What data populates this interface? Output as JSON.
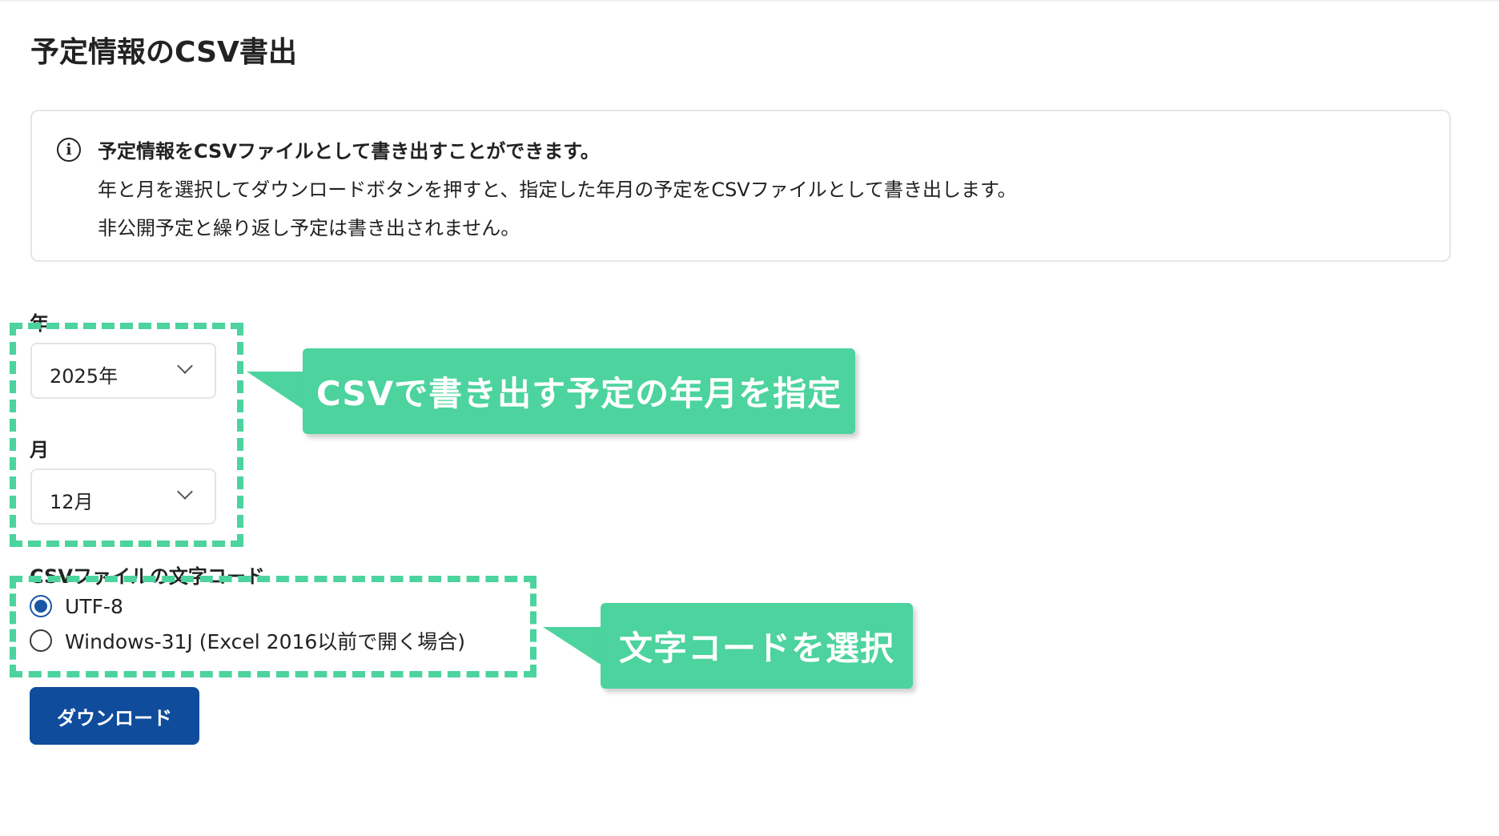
{
  "page": {
    "title": "予定情報のCSV書出"
  },
  "info": {
    "icon": "info-icon",
    "line1": "予定情報をCSVファイルとして書き出すことができます。",
    "line2": "年と月を選択してダウンロードボタンを押すと、指定した年月の予定をCSVファイルとして書き出します。",
    "line3": "非公開予定と繰り返し予定は書き出されません。"
  },
  "form": {
    "year_label": "年",
    "year_value": "2025年",
    "month_label": "月",
    "month_value": "12月",
    "encoding_label": "CSVファイルの文字コード",
    "encoding_options": [
      {
        "label": "UTF-8",
        "checked": true
      },
      {
        "label": "Windows-31J (Excel 2016以前で開く場合)",
        "checked": false
      }
    ],
    "download_label": "ダウンロード"
  },
  "annotations": {
    "callout_date": "CSVで書き出す予定の年月を指定",
    "callout_encoding": "文字コードを選択",
    "highlight_color": "#4cd39e"
  },
  "colors": {
    "primary_button": "#0f4c9c",
    "radio_checked": "#1a56a6"
  }
}
